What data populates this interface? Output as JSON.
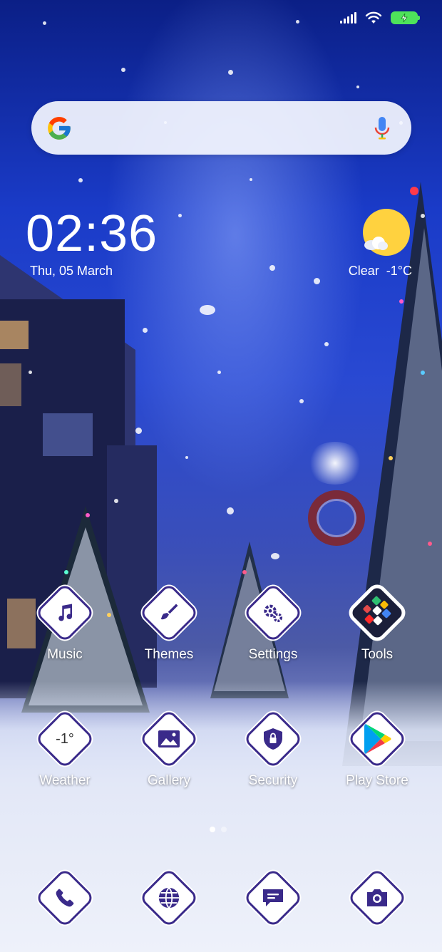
{
  "status": {
    "signal_icon": "signal-bars-icon",
    "wifi_icon": "wifi-icon",
    "battery_icon": "battery-charging-icon",
    "battery_color": "#4ee35a"
  },
  "search": {
    "logo_icon": "google-g-icon",
    "mic_icon": "microphone-icon"
  },
  "clock": {
    "time": "02:36",
    "date": "Thu, 05 March"
  },
  "weather": {
    "condition": "Clear",
    "temperature": "-1°C",
    "icon": "sun-cloud-icon"
  },
  "apps_row1": [
    {
      "label": "Music",
      "icon": "music-note-icon"
    },
    {
      "label": "Themes",
      "icon": "paintbrush-icon"
    },
    {
      "label": "Settings",
      "icon": "gears-icon"
    },
    {
      "label": "Tools",
      "icon": "folder-icon"
    }
  ],
  "apps_row2": [
    {
      "label": "Weather",
      "icon": "weather-icon",
      "value": "-1°"
    },
    {
      "label": "Gallery",
      "icon": "image-icon"
    },
    {
      "label": "Security",
      "icon": "shield-lock-icon"
    },
    {
      "label": "Play Store",
      "icon": "play-store-icon"
    }
  ],
  "dock": [
    {
      "icon": "phone-icon"
    },
    {
      "icon": "browser-globe-icon"
    },
    {
      "icon": "messages-icon"
    },
    {
      "icon": "camera-icon"
    }
  ],
  "pager": {
    "pages": 2,
    "current": 1
  },
  "colors": {
    "icon_accent": "#3a2a8a",
    "icon_bg": "#ffffff"
  }
}
